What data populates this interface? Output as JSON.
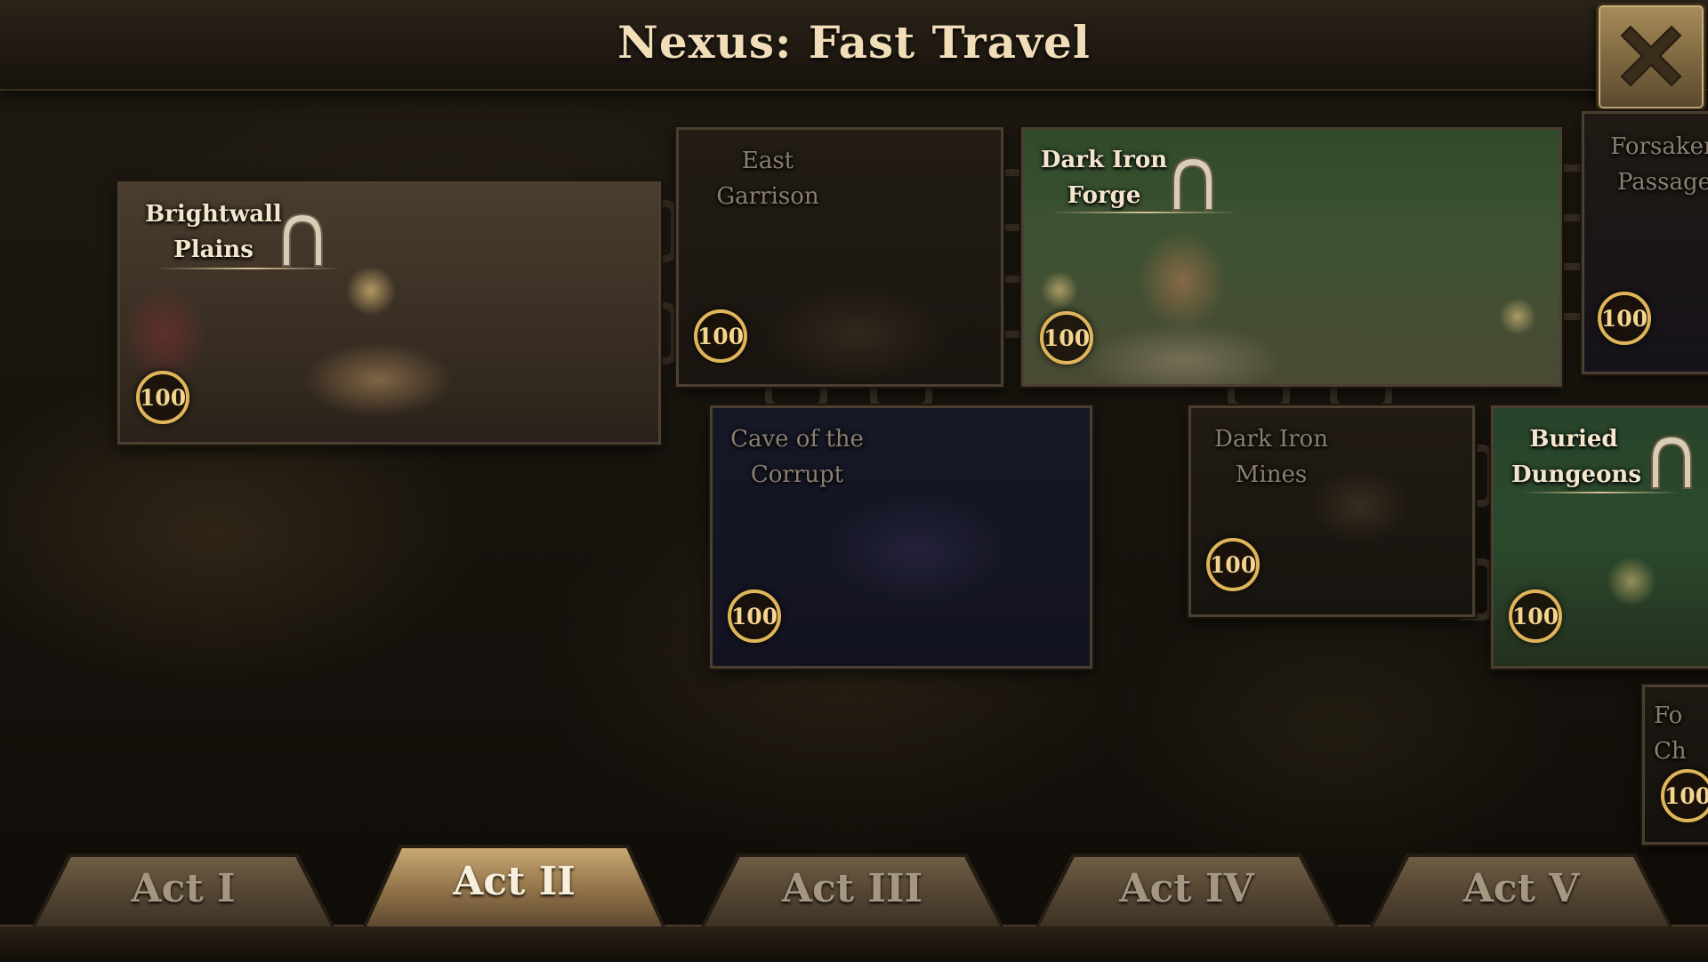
{
  "header": {
    "title": "Nexus: Fast Travel"
  },
  "close_button": {
    "icon": "close-icon"
  },
  "locations": [
    {
      "id": "brightwall-plains",
      "line1": "Brightwall",
      "line2": "Plains",
      "badge": "100",
      "unlocked": true,
      "has_arch": true
    },
    {
      "id": "east-garrison",
      "line1": "East",
      "line2": "Garrison",
      "badge": "100",
      "unlocked": false,
      "has_arch": false
    },
    {
      "id": "dark-iron-forge",
      "line1": "Dark Iron",
      "line2": "Forge",
      "badge": "100",
      "unlocked": true,
      "has_arch": true
    },
    {
      "id": "forsaken-passage",
      "line1": "Forsaken",
      "line2": "Passage",
      "badge": "100",
      "unlocked": false,
      "has_arch": false
    },
    {
      "id": "cave-of-the-corrupt",
      "line1": "Cave of the",
      "line2": "Corrupt",
      "badge": "100",
      "unlocked": false,
      "has_arch": false
    },
    {
      "id": "dark-iron-mines",
      "line1": "Dark Iron",
      "line2": "Mines",
      "badge": "100",
      "unlocked": false,
      "has_arch": false
    },
    {
      "id": "buried-dungeons",
      "line1": "Buried",
      "line2": "Dungeons",
      "badge": "100",
      "unlocked": true,
      "has_arch": true
    },
    {
      "id": "partial-tile",
      "line1": "Fo",
      "line2": "Ch",
      "badge": "100",
      "unlocked": false,
      "has_arch": false
    }
  ],
  "tabs": [
    {
      "label": "Act I",
      "active": false
    },
    {
      "label": "Act II",
      "active": true
    },
    {
      "label": "Act III",
      "active": false
    },
    {
      "label": "Act IV",
      "active": false
    },
    {
      "label": "Act V",
      "active": false
    }
  ],
  "colors": {
    "badge_ring": "#e0b55a",
    "title_text": "#f1ddb8",
    "active_tab": "#c9a873"
  }
}
